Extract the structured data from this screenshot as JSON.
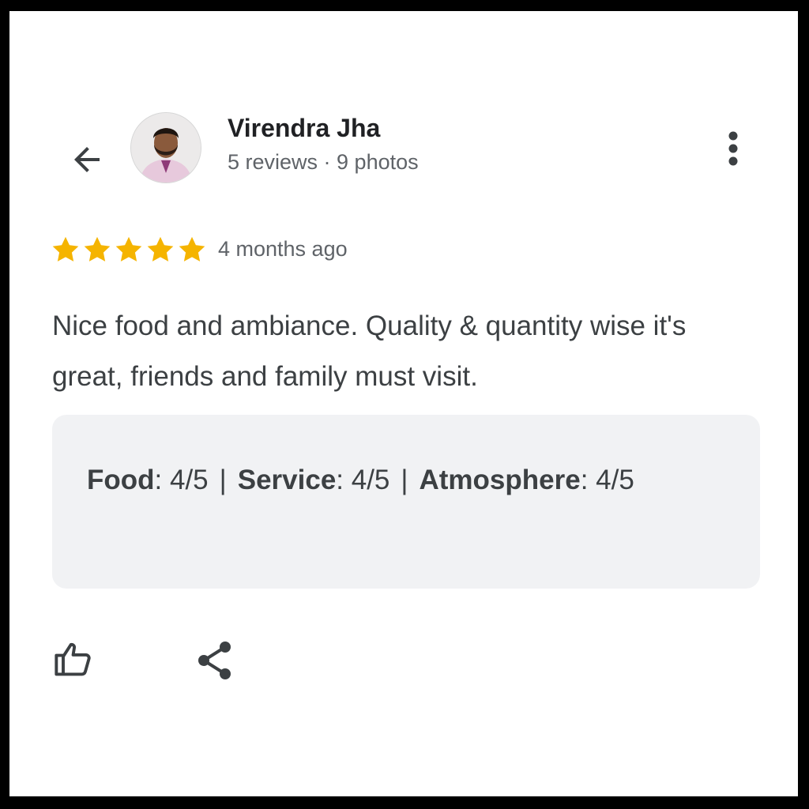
{
  "reviewer": {
    "name": "Virendra Jha",
    "stats": "5 reviews · 9 photos"
  },
  "review": {
    "rating": 5,
    "rating_max": 5,
    "time_ago": "4 months ago",
    "text": "Nice food and ambiance. Quality & quantity wise it's great, friends and family must visit."
  },
  "ratings": {
    "food_label": "Food",
    "food_value": ": 4/5",
    "service_label": "Service",
    "service_value": ": 4/5",
    "atmosphere_label": "Atmosphere",
    "atmosphere_value": ": 4/5",
    "separator": "|"
  },
  "icons": {
    "back": "arrow-left-icon",
    "more": "more-vert-icon",
    "star": "star-icon",
    "like": "thumb-up-icon",
    "share": "share-icon"
  },
  "colors": {
    "star": "#f5b400",
    "text_primary": "#202124",
    "text_secondary": "#5f6368",
    "card_bg": "#f1f2f4"
  }
}
